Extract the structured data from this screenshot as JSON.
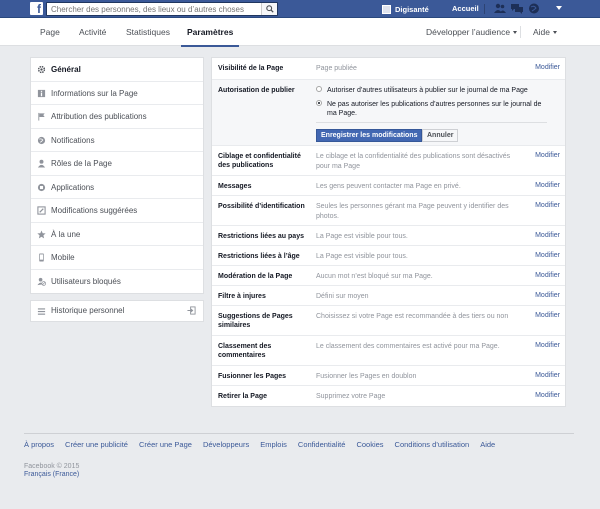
{
  "topbar": {
    "search_placeholder": "Chercher des personnes, des lieux ou d’autres choses",
    "profile_name": "Digisanté",
    "home_label": "Accueil",
    "icons": [
      "friends-icon",
      "messages-icon",
      "notifications-icon"
    ],
    "brand_color": "#3b5998"
  },
  "pagenav": {
    "tabs": [
      {
        "label": "Page"
      },
      {
        "label": "Activité"
      },
      {
        "label": "Statistiques"
      },
      {
        "label": "Paramètres"
      }
    ],
    "promote_label": "Développer l’audience",
    "help_label": "Aide"
  },
  "sidebar": {
    "items": [
      {
        "label": "Général",
        "icon": "gear-icon"
      },
      {
        "label": "Informations sur la Page",
        "icon": "info-icon"
      },
      {
        "label": "Attribution des publications",
        "icon": "flag-icon"
      },
      {
        "label": "Notifications",
        "icon": "globe-icon"
      },
      {
        "label": "Rôles de la Page",
        "icon": "person-icon"
      },
      {
        "label": "Applications",
        "icon": "apps-icon"
      },
      {
        "label": "Modifications suggérées",
        "icon": "edit-icon"
      },
      {
        "label": "À la une",
        "icon": "star-icon"
      },
      {
        "label": "Mobile",
        "icon": "mobile-icon"
      },
      {
        "label": "Utilisateurs bloqués",
        "icon": "blocked-icon"
      }
    ],
    "activity_log": {
      "label": "Historique personnel",
      "icon": "list-icon"
    }
  },
  "settings": {
    "edit_label": "Modifier",
    "rows": [
      {
        "label": "Visibilité de la Page",
        "value": "Page publiée"
      },
      {
        "label": "Autorisation de publier",
        "options": [
          "Autoriser d’autres utilisateurs à publier sur le journal de ma Page",
          "Ne pas autoriser les publications d’autres personnes sur le journal de ma Page."
        ],
        "save_label": "Enregistrer les modifications",
        "cancel_label": "Annuler"
      },
      {
        "label": "Ciblage et confidentialité des publications",
        "value": "Le ciblage et la confidentialité des publications sont désactivés pour ma Page"
      },
      {
        "label": "Messages",
        "value": "Les gens peuvent contacter ma Page en privé."
      },
      {
        "label": "Possibilité d’identification",
        "value": "Seules les personnes gérant ma Page peuvent y identifier des photos."
      },
      {
        "label": "Restrictions liées au pays",
        "value": "La Page est visible pour tous."
      },
      {
        "label": "Restrictions liées à l’âge",
        "value": "La Page est visible pour tous."
      },
      {
        "label": "Modération de la Page",
        "value": "Aucun mot n’est bloqué sur ma Page."
      },
      {
        "label": "Filtre à injures",
        "value": "Défini sur moyen"
      },
      {
        "label": "Suggestions de Pages similaires",
        "value": "Choisissez si votre Page est recommandée à des tiers ou non"
      },
      {
        "label": "Classement des commentaires",
        "value": "Le classement des commentaires est activé pour ma Page."
      },
      {
        "label": "Fusionner les Pages",
        "value": "Fusionner les Pages en doublon"
      },
      {
        "label": "Retirer la Page",
        "value": "Supprimez votre Page"
      }
    ]
  },
  "footer": {
    "links": [
      "À propos",
      "Créer une publicité",
      "Créer une Page",
      "Développeurs",
      "Emplois",
      "Confidentialité",
      "Cookies",
      "Conditions d’utilisation",
      "Aide"
    ],
    "copyright": "Facebook © 2015",
    "language": "Français (France)"
  }
}
